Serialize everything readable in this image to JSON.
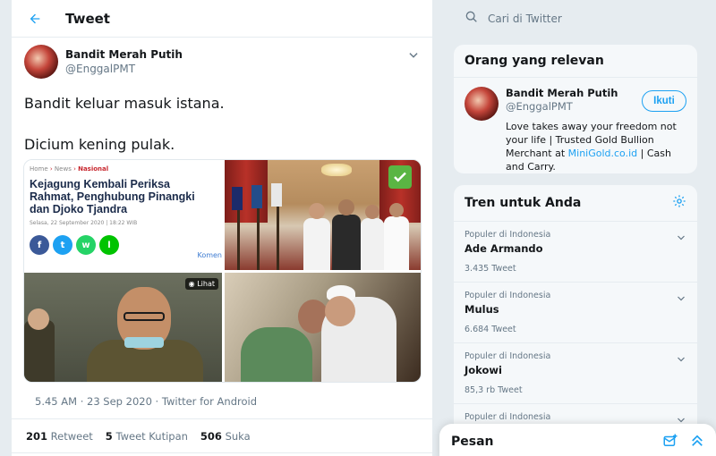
{
  "header": {
    "title": "Tweet"
  },
  "tweet": {
    "author_name": "Bandit Merah Putih",
    "author_handle": "@EnggalPMT",
    "text_line1": "Bandit keluar masuk istana.",
    "text_line2": "Dicium kening pulak.",
    "meta": "5.45 AM · 23 Sep 2020 · Twitter for Android",
    "stats": {
      "retweets_count": "201",
      "retweets_label": "Retweet",
      "quotes_count": "5",
      "quotes_label": "Tweet Kutipan",
      "likes_count": "506",
      "likes_label": "Suka"
    }
  },
  "media": {
    "news": {
      "breadcrumb_home": "Home",
      "breadcrumb_news": "News",
      "breadcrumb_section": "Nasional",
      "headline": "Kejagung Kembali Periksa Rahmat, Penghubung Pinangki dan Djoko Tjandra",
      "date": "Selasa, 22 September 2020 | 18:22 WIB",
      "komen_label": "Komen"
    },
    "lihat_label": "Lihat"
  },
  "search": {
    "placeholder": "Cari di Twitter"
  },
  "relevant": {
    "title": "Orang yang relevan",
    "name": "Bandit Merah Putih",
    "handle": "@EnggalPMT",
    "follow_label": "Ikuti",
    "bio_part1": "Love takes away your freedom not your life | Trusted Gold Bullion Merchant at ",
    "bio_link": "MiniGold.co.id",
    "bio_part2": " | Cash and Carry."
  },
  "trends": {
    "title": "Tren untuk Anda",
    "items": [
      {
        "context": "Populer di Indonesia",
        "name": "Ade Armando",
        "count": "3.435 Tweet"
      },
      {
        "context": "Populer di Indonesia",
        "name": "Mulus",
        "count": "6.684 Tweet"
      },
      {
        "context": "Populer di Indonesia",
        "name": "Jokowi",
        "count": "85,3 rb Tweet"
      },
      {
        "context": "Populer di Indonesia",
        "name": "",
        "count": ""
      }
    ]
  },
  "messages": {
    "title": "Pesan"
  },
  "colors": {
    "accent": "#1da1f2",
    "text": "#14171a",
    "muted": "#657786"
  },
  "icons": [
    "back-arrow-icon",
    "chevron-down-icon",
    "search-icon",
    "gear-icon",
    "new-message-icon",
    "double-chevron-up-icon",
    "eye-icon",
    "check-icon"
  ]
}
